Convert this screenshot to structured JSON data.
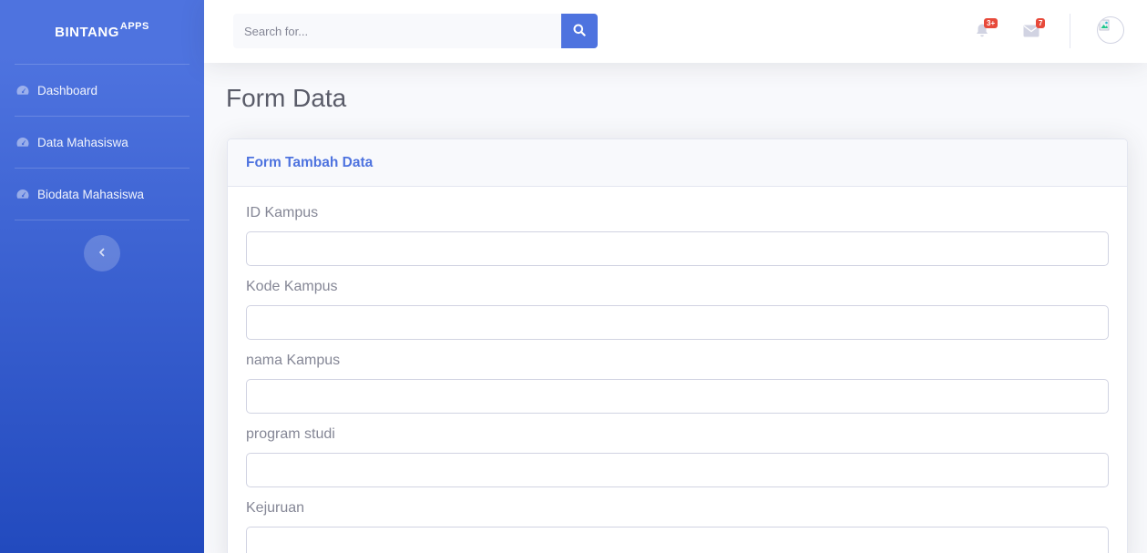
{
  "sidebar": {
    "brand": {
      "name": "BINTANG",
      "sup": "APPS"
    },
    "items": [
      {
        "label": "Dashboard",
        "icon": "tachometer-icon"
      },
      {
        "label": "Data Mahasiswa",
        "icon": "tachometer-icon"
      },
      {
        "label": "Biodata Mahasiswa",
        "icon": "tachometer-icon"
      }
    ],
    "toggle_icon": "chevron-left-icon"
  },
  "topbar": {
    "search": {
      "placeholder": "Search for...",
      "value": ""
    },
    "alerts": {
      "icon": "bell-icon",
      "badge": "3+"
    },
    "messages": {
      "icon": "envelope-icon",
      "badge": "7"
    },
    "avatar": {
      "icon": "user-avatar"
    }
  },
  "page": {
    "title": "Form Data"
  },
  "card": {
    "title": "Form Tambah Data",
    "fields": [
      {
        "label": "ID Kampus",
        "value": ""
      },
      {
        "label": "Kode Kampus",
        "value": ""
      },
      {
        "label": "nama Kampus",
        "value": ""
      },
      {
        "label": "program studi",
        "value": ""
      },
      {
        "label": "Kejuruan",
        "value": ""
      }
    ]
  },
  "colors": {
    "primary": "#4e73df",
    "primary_dark": "#224abe",
    "danger": "#e74a3b",
    "text_gray": "#858796",
    "heading_gray": "#5a5c69"
  }
}
